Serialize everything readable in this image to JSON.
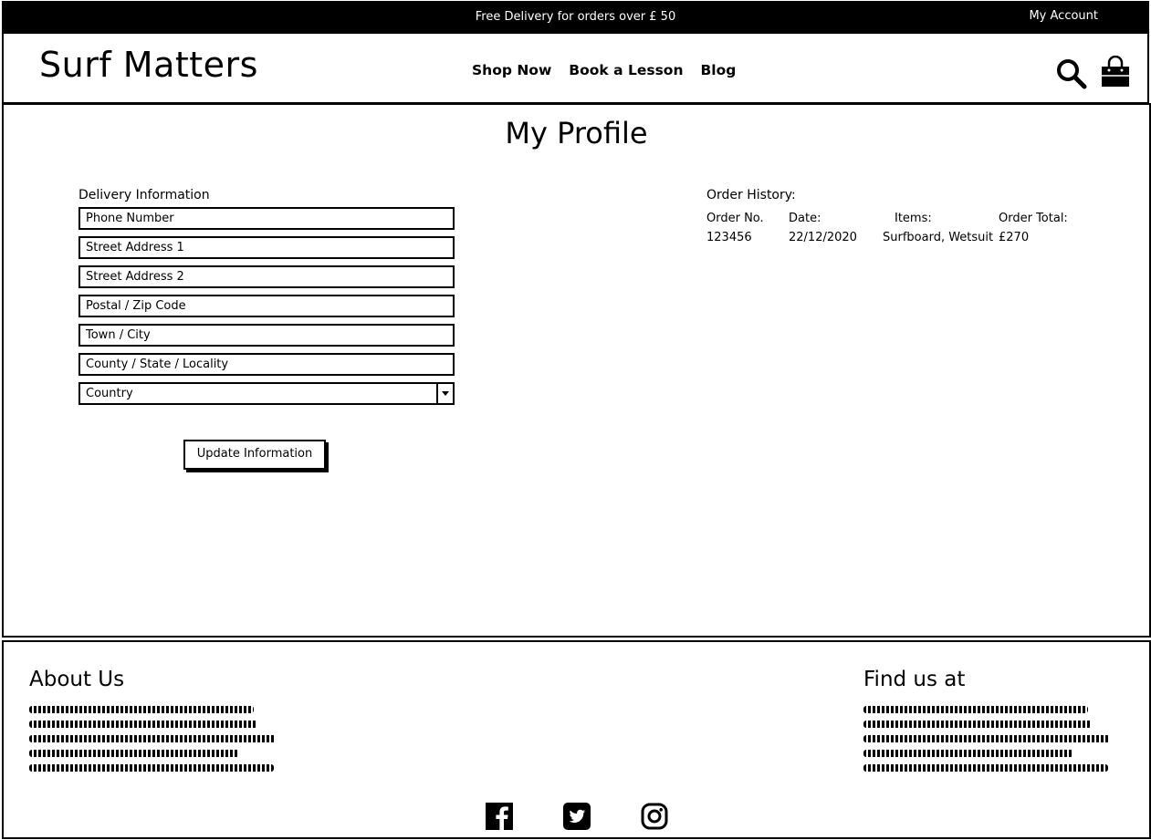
{
  "topbar": {
    "promo": "Free Delivery for orders over £ 50",
    "account": "My Account"
  },
  "header": {
    "logo": "Surf Matters",
    "nav": [
      "Shop Now",
      "Book a Lesson",
      "Blog"
    ],
    "icons": [
      "search-icon",
      "shopping-bag-icon"
    ]
  },
  "main": {
    "title": "My Profile",
    "delivery": {
      "label": "Delivery Information",
      "fields": [
        "Phone Number",
        "Street Address 1",
        "Street Address 2",
        "Postal / Zip Code",
        "Town / City",
        "County / State / Locality"
      ],
      "country": "Country",
      "button": "Update Information"
    },
    "orders": {
      "title": "Order History:",
      "headers": [
        "Order No.",
        "Date:",
        "Items:",
        "Order Total:"
      ],
      "rows": [
        [
          "123456",
          "22/12/2020",
          "Surfboard, Wetsuit",
          "£270"
        ]
      ]
    }
  },
  "footer": {
    "about": "About Us",
    "find": "Find us at",
    "social": [
      "facebook-icon",
      "twitter-icon",
      "instagram-icon"
    ]
  }
}
